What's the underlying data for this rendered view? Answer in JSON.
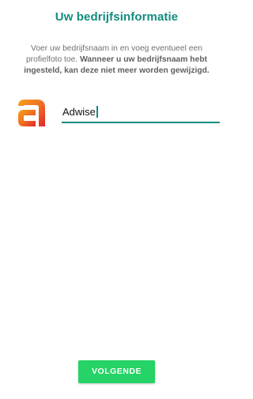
{
  "header": {
    "title": "Uw bedrijfsinformatie"
  },
  "intro": {
    "text": "Voer uw bedrijfsnaam in en voeg eventueel een profielfoto toe. ",
    "bold_text": "Wanneer u uw bedrijfsnaam hebt ingesteld, kan deze niet meer worden gewijzigd."
  },
  "profile": {
    "photo_icon": "adwise-logo-icon",
    "name_value": "Adwise"
  },
  "footer": {
    "next_label": "VOLGENDE"
  },
  "colors": {
    "accent": "#128C7E",
    "button": "#25D366",
    "logo_orange": "#F39A1E",
    "logo_red": "#E4262A"
  }
}
